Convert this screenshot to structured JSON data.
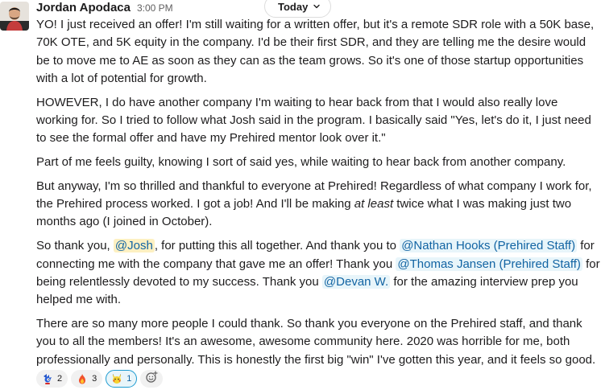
{
  "message": {
    "sender": "Jordan Apodaca",
    "timestamp": "3:00 PM",
    "date_divider": "Today",
    "avatar_icon": "profile-photo",
    "p1": "YO! I just received an offer! I'm still waiting for a written offer, but it's a remote SDR role with a 50K base, 70K OTE, and 5K equity in the company. I'd be their first SDR, and they are telling me the desire would be to move me to AE as soon as they can as the team grows. So it's one of those startup opportunities with a lot of potential for growth.",
    "p2": "HOWEVER, I do have another company I'm waiting to hear back from that I would also really love working for. So I tried to follow what Josh said in the program. I basically said \"Yes, let's do it, I just need to see the formal offer and have my Prehired mentor look over it.\"",
    "p3": "Part of me feels guilty, knowing I sort of said yes, while waiting to hear back from another company.",
    "p4": {
      "a": "But anyway, I'm so thrilled and thankful to everyone at Prehired! Regardless of what company I work for, the Prehired process worked. I got a job! And I'll be making ",
      "italic": "at least",
      "b": " twice what I was making just two months ago (I joined in October)."
    },
    "p5": {
      "a": "So thank you, ",
      "mention_josh": "@Josh",
      "b": ", for putting this all together. And thank you to ",
      "mention_nathan": "@Nathan Hooks (Prehired Staff)",
      "c": " for connecting me with the company that gave me an offer! Thank you ",
      "mention_thomas": "@Thomas Jansen (Prehired Staff)",
      "d": " for being relentlessly devoted to my success. Thank you ",
      "mention_devan": "@Devan W.",
      "e": " for the amazing interview prep you helped me with."
    },
    "p6": "There are so many more people I could thank. So thank you everyone on the Prehired staff, and thank you to all the members! It's an awesome, awesome community here. 2020 was horrible for me, both professionally and personally. This is honestly the first big \"win\" I've gotten this year, and it feels so good."
  },
  "reactions": [
    {
      "icon": "sonic-emoji",
      "count": "2",
      "active": false
    },
    {
      "icon": "fire-emoji",
      "count": "3",
      "active": false
    },
    {
      "icon": "pikachu-emoji",
      "count": "1",
      "active": true
    }
  ],
  "add_reaction_icon": "add-emoji-icon",
  "colors": {
    "mention_text": "#1264a3",
    "mention_bg": "#e8f5fa",
    "self_mention_bg": "#fdf0c2",
    "active_reaction_border": "#1d9bd1"
  }
}
